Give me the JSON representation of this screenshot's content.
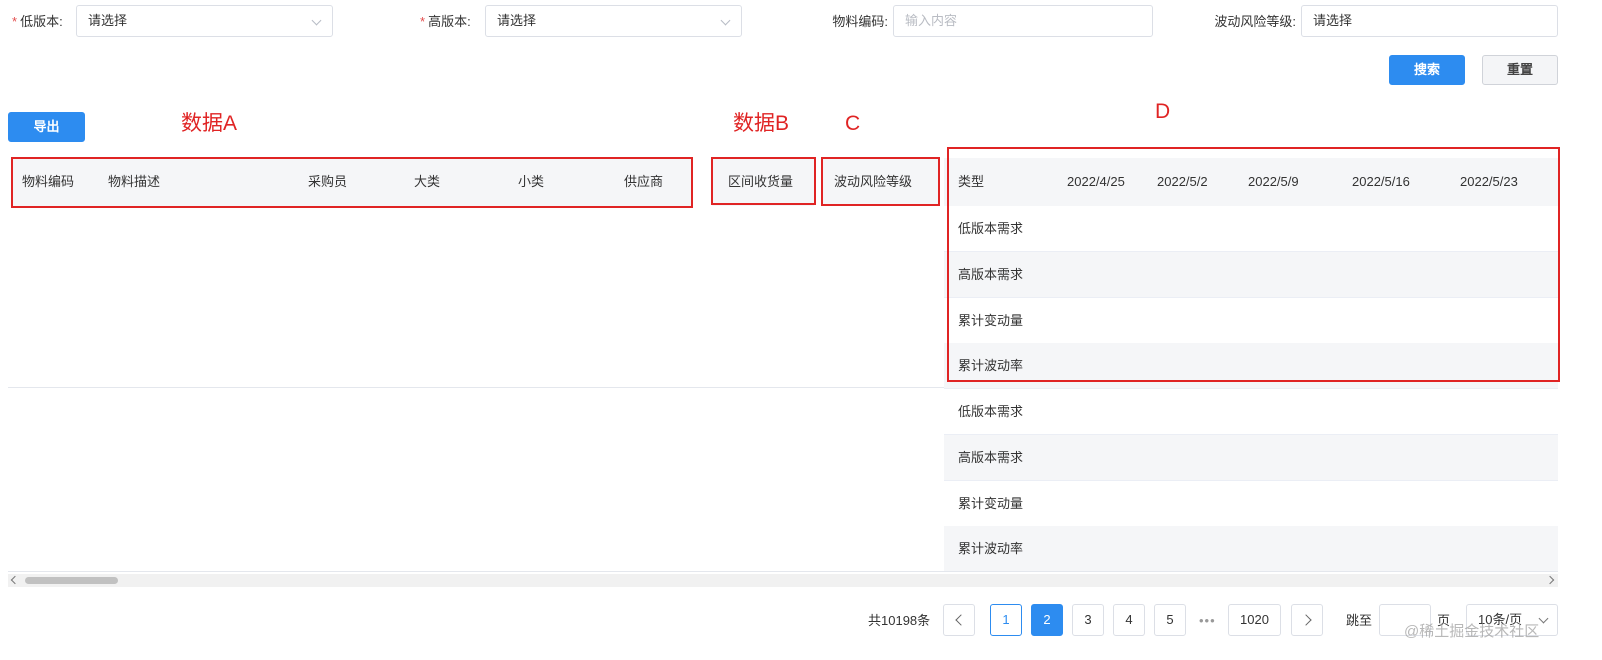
{
  "filters": {
    "low_version": {
      "label": "低版本:",
      "placeholder": "请选择"
    },
    "high_version": {
      "label": "高版本:",
      "placeholder": "请选择"
    },
    "material_code": {
      "label": "物料编码:",
      "placeholder": "输入内容"
    },
    "risk_level": {
      "label": "波动风险等级:",
      "placeholder": "请选择"
    },
    "required_mark": "*"
  },
  "buttons": {
    "search": "搜索",
    "reset": "重置",
    "export": "导出"
  },
  "annotations": {
    "a": "数据A",
    "b": "数据B",
    "c": "C",
    "d": "D"
  },
  "table_a": {
    "columns": [
      "物料编码",
      "物料描述",
      "采购员",
      "大类",
      "小类",
      "供应商"
    ]
  },
  "table_b": {
    "columns": [
      "区间收货量"
    ]
  },
  "table_c": {
    "columns": [
      "波动风险等级"
    ]
  },
  "table_d": {
    "columns": [
      "类型",
      "2022/4/25",
      "2022/5/2",
      "2022/5/9",
      "2022/5/16",
      "2022/5/23"
    ],
    "rows": [
      "低版本需求",
      "高版本需求",
      "累计变动量",
      "累计波动率",
      "低版本需求",
      "高版本需求",
      "累计变动量",
      "累计波动率"
    ]
  },
  "pagination": {
    "total": "共10198条",
    "pages": [
      "1",
      "2",
      "3",
      "4",
      "5"
    ],
    "ellipsis": "•••",
    "last": "1020",
    "jump_label": "跳至",
    "page_unit": "页",
    "page_size": "10条/页",
    "active_page": "2"
  },
  "watermark": "@稀土掘金技术社区",
  "colors": {
    "primary": "#2d8cf0",
    "annotation": "#e02424",
    "header_bg": "#f5f6f8"
  }
}
